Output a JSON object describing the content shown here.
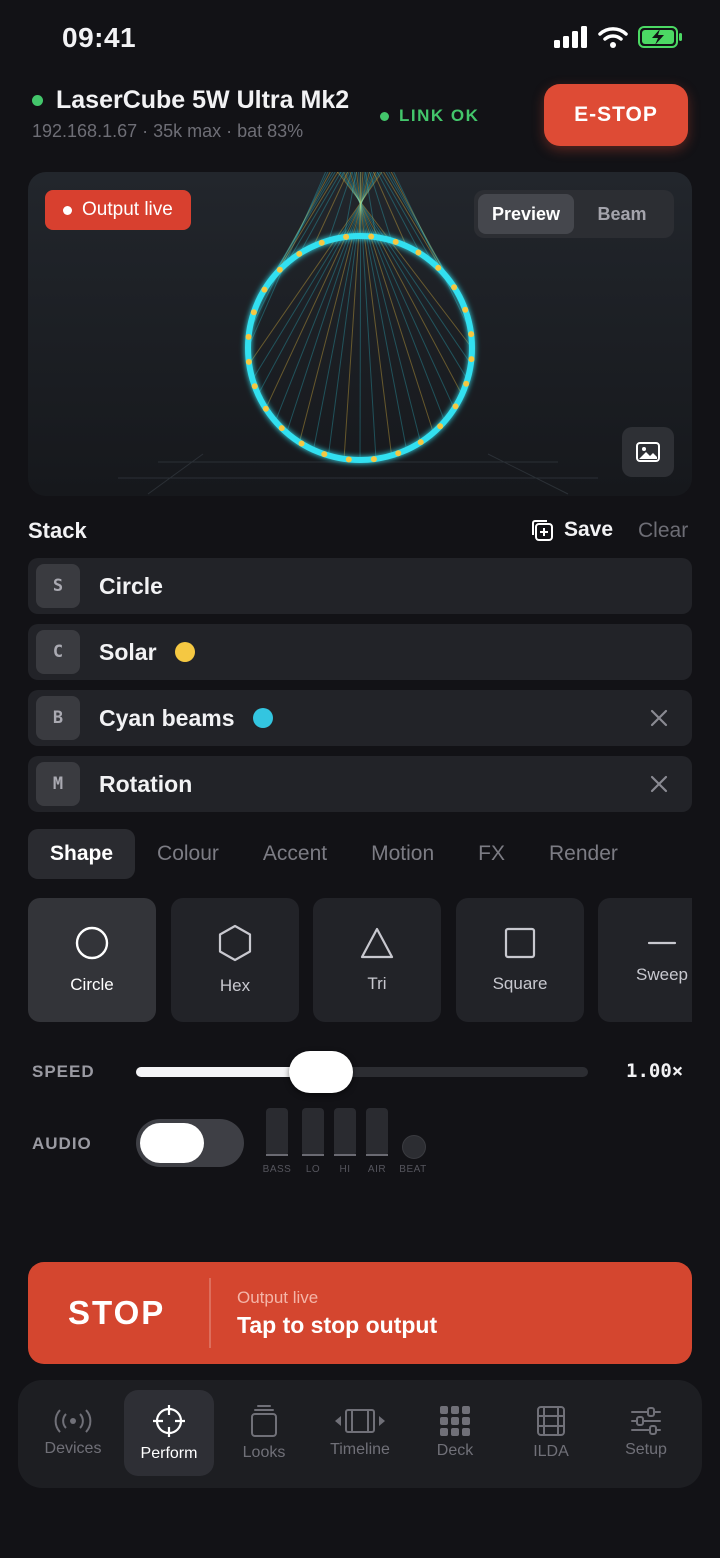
{
  "status_bar": {
    "time": "09:41"
  },
  "device": {
    "name": "LaserCube 5W Ultra Mk2",
    "subtitle": "192.168.1.67 · 35k max · bat 83%",
    "link_status": "LINK OK",
    "estop_label": "E-STOP"
  },
  "preview": {
    "badge": "Output live",
    "modes": [
      "Preview",
      "Beam"
    ],
    "active_mode": "Preview"
  },
  "stack": {
    "title": "Stack",
    "save_label": "Save",
    "clear_label": "Clear",
    "items": [
      {
        "key": "S",
        "label": "Circle",
        "dot_color": null,
        "removable": false
      },
      {
        "key": "C",
        "label": "Solar",
        "dot_color": "#f5c842",
        "removable": false
      },
      {
        "key": "B",
        "label": "Cyan beams",
        "dot_color": "#33c5e0",
        "removable": true
      },
      {
        "key": "M",
        "label": "Rotation",
        "dot_color": null,
        "removable": true
      }
    ]
  },
  "tabs": [
    "Shape",
    "Colour",
    "Accent",
    "Motion",
    "FX",
    "Render"
  ],
  "active_tab": "Shape",
  "shapes": [
    {
      "label": "Circle",
      "icon": "circle-icon",
      "selected": true
    },
    {
      "label": "Hex",
      "icon": "hexagon-icon",
      "selected": false
    },
    {
      "label": "Tri",
      "icon": "triangle-icon",
      "selected": false
    },
    {
      "label": "Square",
      "icon": "square-icon",
      "selected": false
    },
    {
      "label": "Sweep",
      "icon": "line-icon",
      "selected": false
    }
  ],
  "speed": {
    "label": "SPEED",
    "value": "1.00×",
    "fraction": 0.41
  },
  "audio": {
    "label": "AUDIO",
    "enabled": false,
    "meters": [
      "BASS",
      "LO",
      "HI",
      "AIR"
    ],
    "beat_label": "BEAT"
  },
  "stop_button": {
    "label": "STOP",
    "sub": "Output live",
    "main": "Tap to stop output"
  },
  "nav": {
    "items": [
      "Devices",
      "Perform",
      "Looks",
      "Timeline",
      "Deck",
      "ILDA",
      "Setup"
    ],
    "active": "Perform"
  },
  "colors": {
    "accent_red": "#de4b35",
    "link_green": "#43c66b",
    "beam_cyan": "#33e0f0",
    "solar_yellow": "#f5c842"
  }
}
